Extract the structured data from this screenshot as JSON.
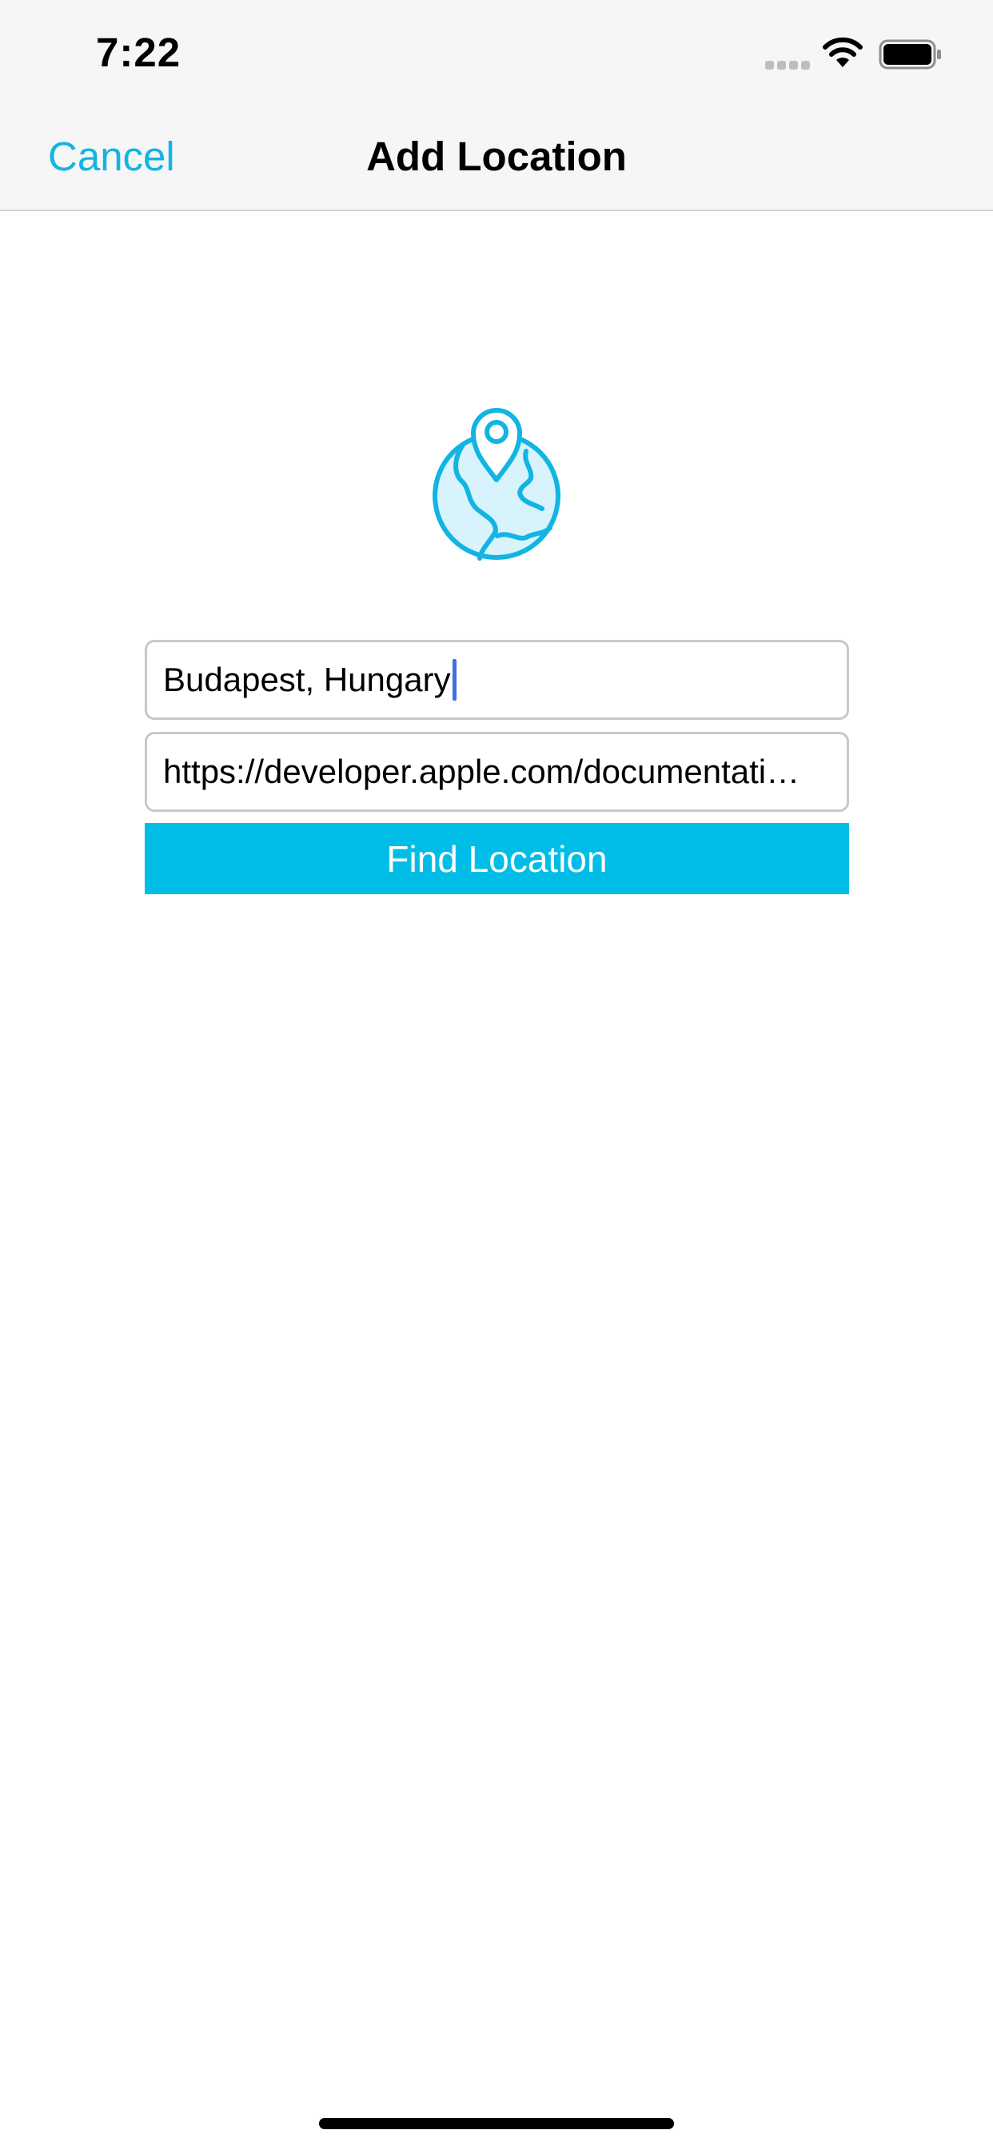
{
  "status_bar": {
    "time": "7:22"
  },
  "nav_bar": {
    "cancel_label": "Cancel",
    "title": "Add Location"
  },
  "icons": {
    "hero": "globe-location-pin-icon",
    "wifi": "wifi-icon",
    "battery": "battery-icon",
    "signal": "cellular-signal-icon"
  },
  "form": {
    "location_value": "Budapest, Hungary",
    "url_value": "https://developer.apple.com/documentati…",
    "find_button_label": "Find Location"
  },
  "colors": {
    "accent": "#12b5e2",
    "button_background": "#00bde8",
    "caret": "#3d6ee8"
  }
}
